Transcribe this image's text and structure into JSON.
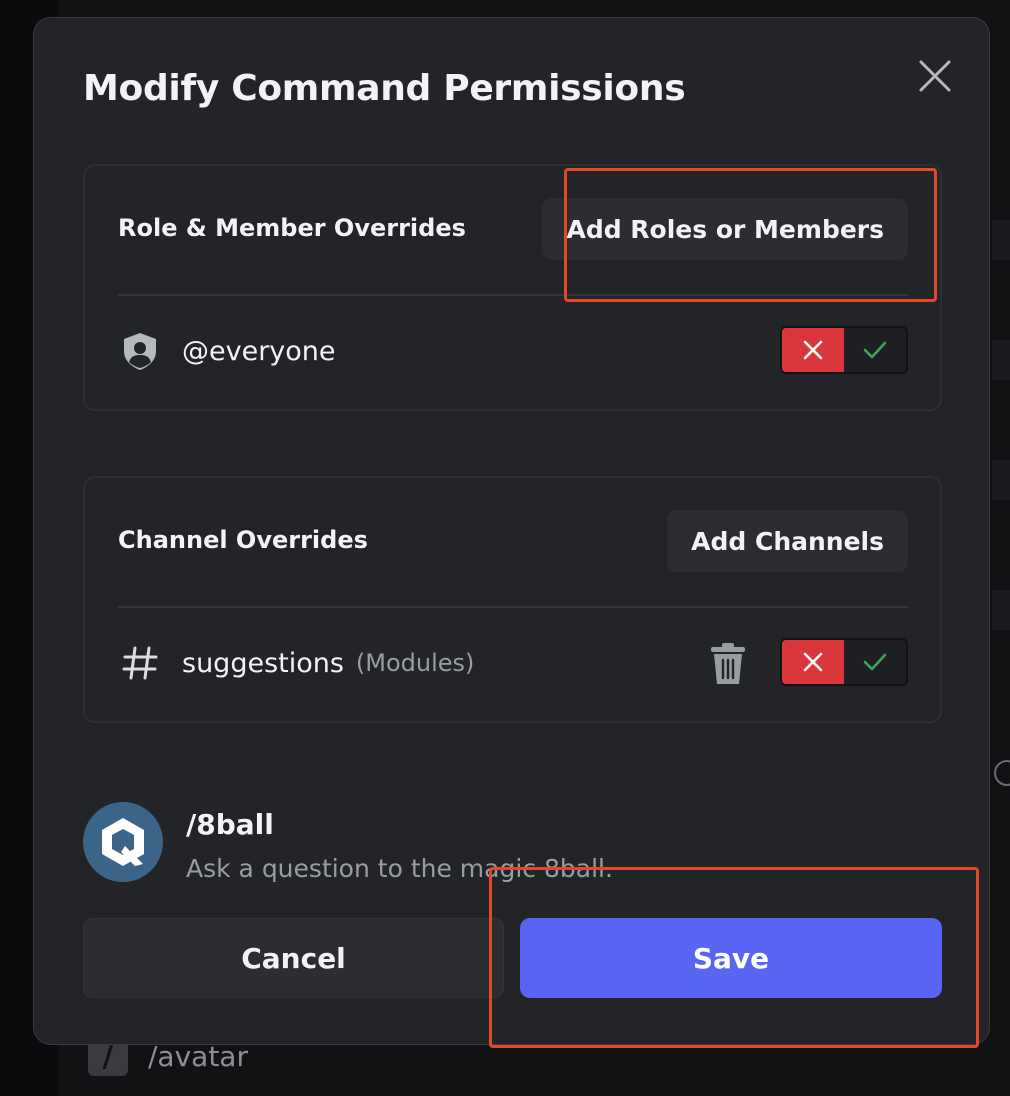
{
  "modal": {
    "title": "Modify Command Permissions"
  },
  "role_overrides": {
    "title": "Role & Member Overrides",
    "add_button": "Add Roles or Members",
    "rows": [
      {
        "label": "@everyone",
        "state": "deny"
      }
    ]
  },
  "channel_overrides": {
    "title": "Channel Overrides",
    "add_button": "Add Channels",
    "rows": [
      {
        "label": "suggestions",
        "category": "(Modules)",
        "state": "deny"
      }
    ]
  },
  "command": {
    "name": "/8ball",
    "description": "Ask a question to the magic 8ball."
  },
  "footer": {
    "cancel_label": "Cancel",
    "save_label": "Save"
  },
  "background": {
    "command_label": "/avatar"
  },
  "colors": {
    "accent": "#5865f2",
    "deny": "#da373c",
    "allow": "#3ba55c",
    "highlight": "#e2492b",
    "avatar": "#3b6489"
  }
}
